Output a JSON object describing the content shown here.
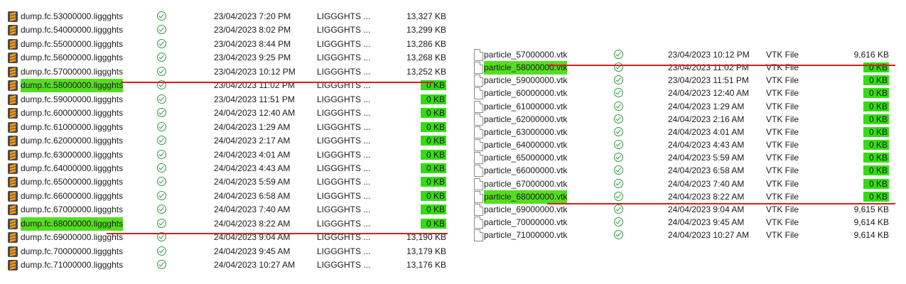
{
  "left": {
    "rows": [
      {
        "name": "dump.fc.53000000.liggghts",
        "date": "23/04/2023 7:20 PM",
        "type": "LIGGGHTS ...",
        "size": "13,327 KB"
      },
      {
        "name": "dump.fc.54000000.liggghts",
        "date": "23/04/2023 8:02 PM",
        "type": "LIGGGHTS ...",
        "size": "13,299 KB"
      },
      {
        "name": "dump.fc.55000000.liggghts",
        "date": "23/04/2023 8:44 PM",
        "type": "LIGGGHTS ...",
        "size": "13,286 KB"
      },
      {
        "name": "dump.fc.56000000.liggghts",
        "date": "23/04/2023 9:25 PM",
        "type": "LIGGGHTS ...",
        "size": "13,268 KB"
      },
      {
        "name": "dump.fc.57000000.liggghts",
        "date": "23/04/2023 10:12 PM",
        "type": "LIGGGHTS ...",
        "size": "13,252 KB"
      },
      {
        "name": "dump.fc.58000000.liggghts",
        "date": "23/04/2023 11:02 PM",
        "type": "LIGGGHTS ...",
        "size": "0 KB",
        "hl": true
      },
      {
        "name": "dump.fc.59000000.liggghts",
        "date": "23/04/2023 11:51 PM",
        "type": "LIGGGHTS ...",
        "size": "0 KB"
      },
      {
        "name": "dump.fc.60000000.liggghts",
        "date": "24/04/2023 12:40 AM",
        "type": "LIGGGHTS ...",
        "size": "0 KB"
      },
      {
        "name": "dump.fc.61000000.liggghts",
        "date": "24/04/2023 1:29 AM",
        "type": "LIGGGHTS ...",
        "size": "0 KB"
      },
      {
        "name": "dump.fc.62000000.liggghts",
        "date": "24/04/2023 2:17 AM",
        "type": "LIGGGHTS ...",
        "size": "0 KB"
      },
      {
        "name": "dump.fc.63000000.liggghts",
        "date": "24/04/2023 4:01 AM",
        "type": "LIGGGHTS ...",
        "size": "0 KB"
      },
      {
        "name": "dump.fc.64000000.liggghts",
        "date": "24/04/2023 4:43 AM",
        "type": "LIGGGHTS ...",
        "size": "0 KB"
      },
      {
        "name": "dump.fc.65000000.liggghts",
        "date": "24/04/2023 5:59 AM",
        "type": "LIGGGHTS ...",
        "size": "0 KB"
      },
      {
        "name": "dump.fc.66000000.liggghts",
        "date": "24/04/2023 6:58 AM",
        "type": "LIGGGHTS ...",
        "size": "0 KB"
      },
      {
        "name": "dump.fc.67000000.liggghts",
        "date": "24/04/2023 7:40 AM",
        "type": "LIGGGHTS ...",
        "size": "0 KB"
      },
      {
        "name": "dump.fc.68000000.liggghts",
        "date": "24/04/2023 8:22 AM",
        "type": "LIGGGHTS ...",
        "size": "0 KB",
        "hl": true
      },
      {
        "name": "dump.fc.69000000.liggghts",
        "date": "24/04/2023 9:04 AM",
        "type": "LIGGGHTS ...",
        "size": "13,190 KB"
      },
      {
        "name": "dump.fc.70000000.liggghts",
        "date": "24/04/2023 9:45 AM",
        "type": "LIGGGHTS ...",
        "size": "13,179 KB"
      },
      {
        "name": "dump.fc.71000000.liggghts",
        "date": "24/04/2023 10:27 AM",
        "type": "LIGGGHTS ...",
        "size": "13,176 KB"
      }
    ]
  },
  "right": {
    "rows": [
      {
        "name": "particle_57000000.vtk",
        "date": "23/04/2023 10:12 PM",
        "type": "VTK File",
        "size": "9,616 KB"
      },
      {
        "name": "particle_58000000.vtk",
        "date": "23/04/2023 11:02 PM",
        "type": "VTK File",
        "size": "0 KB",
        "hl": true
      },
      {
        "name": "particle_59000000.vtk",
        "date": "23/04/2023 11:51 PM",
        "type": "VTK File",
        "size": "0 KB"
      },
      {
        "name": "particle_60000000.vtk",
        "date": "24/04/2023 12:40 AM",
        "type": "VTK File",
        "size": "0 KB"
      },
      {
        "name": "particle_61000000.vtk",
        "date": "24/04/2023 1:29 AM",
        "type": "VTK File",
        "size": "0 KB"
      },
      {
        "name": "particle_62000000.vtk",
        "date": "24/04/2023 2:16 AM",
        "type": "VTK File",
        "size": "0 KB"
      },
      {
        "name": "particle_63000000.vtk",
        "date": "24/04/2023 4:01 AM",
        "type": "VTK File",
        "size": "0 KB"
      },
      {
        "name": "particle_64000000.vtk",
        "date": "24/04/2023 4:43 AM",
        "type": "VTK File",
        "size": "0 KB"
      },
      {
        "name": "particle_65000000.vtk",
        "date": "24/04/2023 5:59 AM",
        "type": "VTK File",
        "size": "0 KB"
      },
      {
        "name": "particle_66000000.vtk",
        "date": "24/04/2023 6:58 AM",
        "type": "VTK File",
        "size": "0 KB"
      },
      {
        "name": "particle_67000000.vtk",
        "date": "24/04/2023 7:40 AM",
        "type": "VTK File",
        "size": "0 KB"
      },
      {
        "name": "particle_68000000.vtk",
        "date": "24/04/2023 8:22 AM",
        "type": "VTK File",
        "size": "0 KB",
        "hl": true
      },
      {
        "name": "particle_69000000.vtk",
        "date": "24/04/2023 9:04 AM",
        "type": "VTK File",
        "size": "9,615 KB"
      },
      {
        "name": "particle_70000000.vtk",
        "date": "24/04/2023 9:45 AM",
        "type": "VTK File",
        "size": "9,614 KB"
      },
      {
        "name": "particle_71000000.vtk",
        "date": "24/04/2023 10:27 AM",
        "type": "VTK File",
        "size": "9,614 KB"
      }
    ]
  },
  "colors": {
    "highlight": "#33dd11",
    "marker_line": "#d72020",
    "status_ok": "#2e9a3e"
  },
  "icons": {
    "left_file": "sublime-text-icon",
    "right_file": "document-icon",
    "status": "sync-complete-check-icon"
  }
}
